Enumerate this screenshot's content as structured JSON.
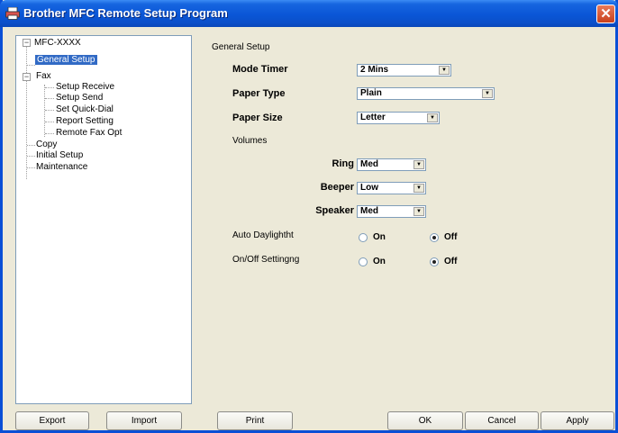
{
  "window": {
    "title": "Brother MFC Remote Setup Program",
    "close_glyph": "✕"
  },
  "tree": {
    "root": "MFC-XXXX",
    "general_setup": "General Setup",
    "fax": "Fax",
    "setup_receive": "Setup Receive",
    "setup_send": "Setup Send",
    "set_quick_dial": "Set Quick-Dial",
    "report_setting": "Report Setting",
    "remote_fax_opt": "Remote Fax Opt",
    "copy": "Copy",
    "initial_setup": "Initial Setup",
    "maintenance": "Maintenance",
    "collapse_glyph": "−"
  },
  "panel": {
    "title": "General Setup",
    "mode_timer": {
      "label": "Mode Timer",
      "value": "2 Mins"
    },
    "paper_type": {
      "label": "Paper Type",
      "value": "Plain"
    },
    "paper_size": {
      "label": "Paper Size",
      "value": "Letter"
    },
    "volumes": {
      "label": "Volumes",
      "ring": {
        "label": "Ring",
        "value": "Med"
      },
      "beeper": {
        "label": "Beeper",
        "value": "Low"
      },
      "speaker": {
        "label": "Speaker",
        "value": "Med"
      }
    },
    "auto_daylight": {
      "label": "Auto Daylightht",
      "on": "On",
      "off": "Off",
      "selected": "Off"
    },
    "onoff_setting": {
      "label": "On/Off Settingng",
      "on": "On",
      "off": "Off",
      "selected": "Off"
    },
    "arrow_glyph": "▼"
  },
  "buttons": {
    "export": "Export",
    "import": "Import",
    "print": "Print",
    "ok": "OK",
    "cancel": "Cancel",
    "apply": "Apply"
  }
}
